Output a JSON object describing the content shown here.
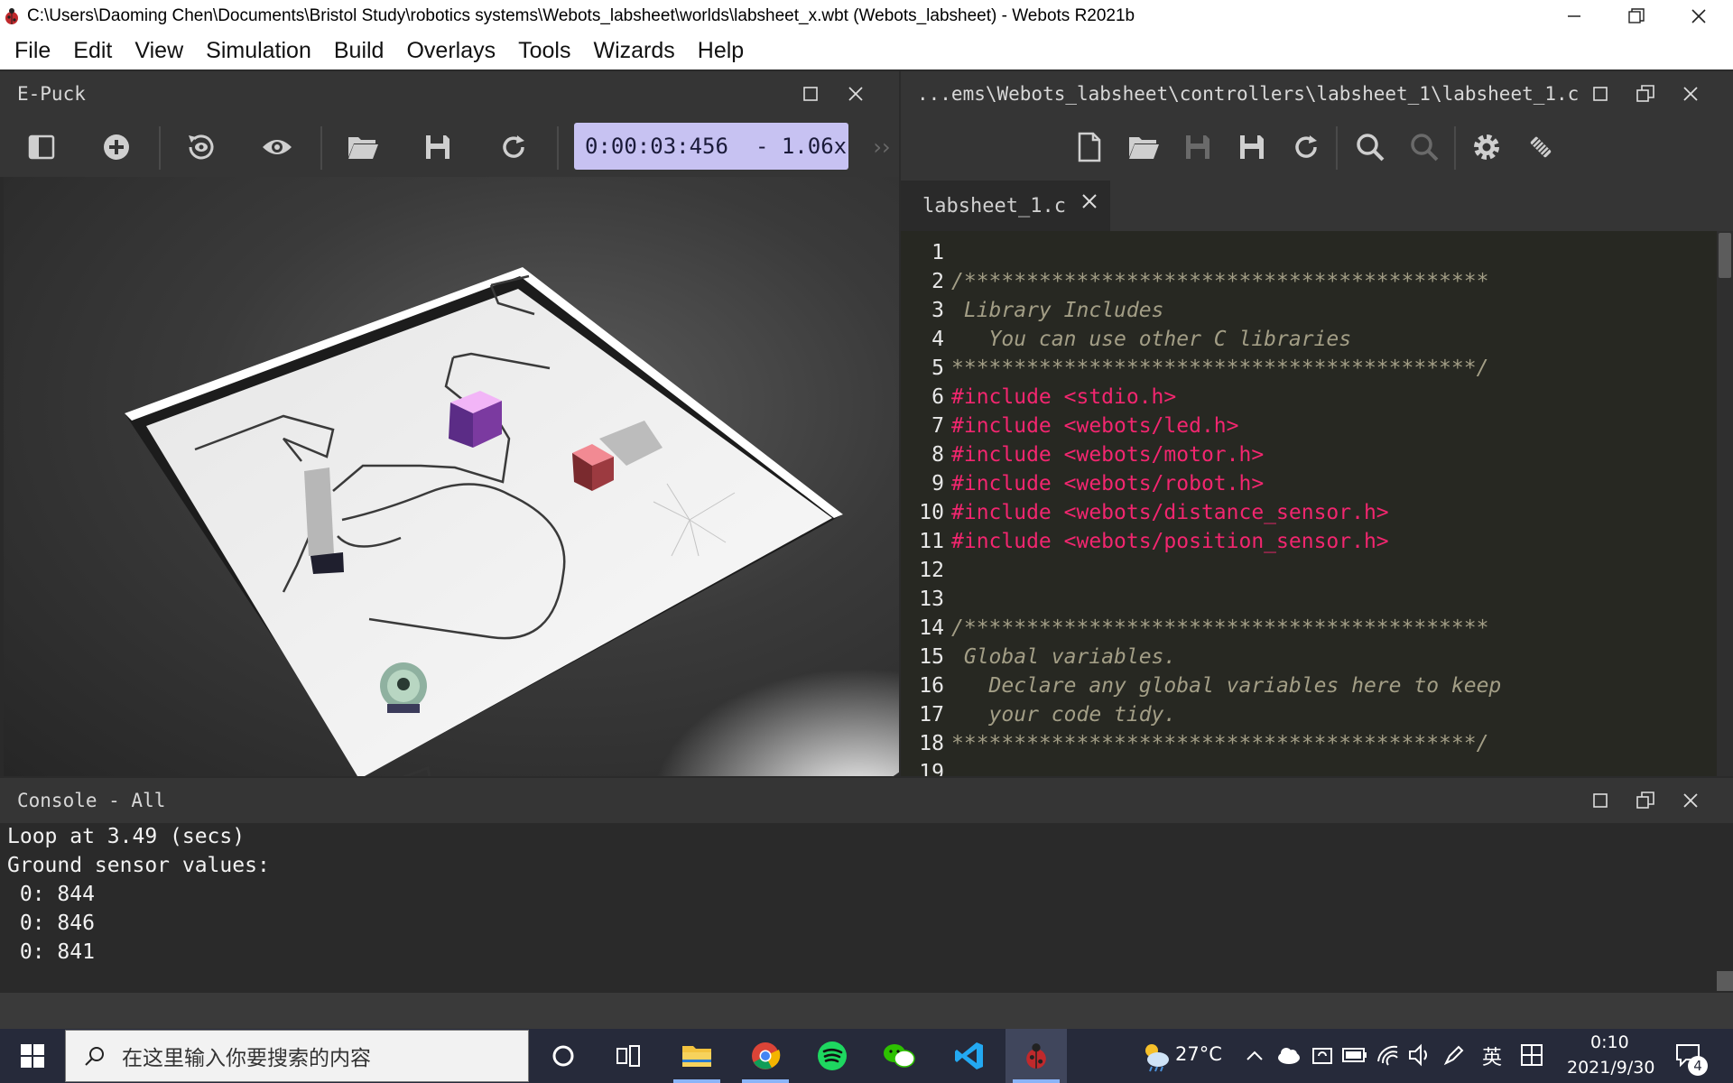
{
  "window": {
    "title": "C:\\Users\\Daoming Chen\\Documents\\Bristol Study\\robotics systems\\Webots_labsheet\\worlds\\labsheet_x.wbt (Webots_labsheet) - Webots R2021b"
  },
  "menu": [
    "File",
    "Edit",
    "View",
    "Simulation",
    "Build",
    "Overlays",
    "Tools",
    "Wizards",
    "Help"
  ],
  "scene_panel": {
    "title": "E-Puck",
    "time": "0:00:03:456",
    "speed": "-  1.06x",
    "more": "››"
  },
  "editor_panel": {
    "title": "...ems\\Webots_labsheet\\controllers\\labsheet_1\\labsheet_1.c",
    "tab_label": "labsheet_1.c",
    "lines": [
      {
        "n": "1",
        "text": "",
        "kind": "plain"
      },
      {
        "n": "2",
        "text": "/******************************************",
        "kind": "comment"
      },
      {
        "n": "3",
        "text": " Library Includes",
        "kind": "comment"
      },
      {
        "n": "4",
        "text": "   You can use other C libraries",
        "kind": "comment"
      },
      {
        "n": "5",
        "text": "******************************************/",
        "kind": "comment"
      },
      {
        "n": "6",
        "text": "#include <stdio.h>",
        "kind": "pre"
      },
      {
        "n": "7",
        "text": "#include <webots/led.h>",
        "kind": "pre"
      },
      {
        "n": "8",
        "text": "#include <webots/motor.h>",
        "kind": "pre"
      },
      {
        "n": "9",
        "text": "#include <webots/robot.h>",
        "kind": "pre"
      },
      {
        "n": "10",
        "text": "#include <webots/distance_sensor.h>",
        "kind": "pre"
      },
      {
        "n": "11",
        "text": "#include <webots/position_sensor.h>",
        "kind": "pre"
      },
      {
        "n": "12",
        "text": "",
        "kind": "plain"
      },
      {
        "n": "13",
        "text": "",
        "kind": "plain"
      },
      {
        "n": "14",
        "text": "/******************************************",
        "kind": "comment"
      },
      {
        "n": "15",
        "text": " Global variables.",
        "kind": "comment"
      },
      {
        "n": "16",
        "text": "   Declare any global variables here to keep",
        "kind": "comment"
      },
      {
        "n": "17",
        "text": "   your code tidy.",
        "kind": "comment"
      },
      {
        "n": "18",
        "text": "******************************************/",
        "kind": "comment"
      },
      {
        "n": "19",
        "text": "",
        "kind": "plain"
      }
    ]
  },
  "console": {
    "title": "Console - All",
    "lines": [
      "Loop at 3.49 (secs)",
      "Ground sensor values:",
      " 0: 844",
      " 0: 846",
      " 0: 841"
    ]
  },
  "taskbar": {
    "search_placeholder": "在这里输入你要搜索的内容",
    "weather": "27°C",
    "ime": "英",
    "time": "0:10",
    "date": "2021/9/30",
    "notifications": "4"
  },
  "colors": {
    "comment": "#a39e86",
    "preprocessor": "#f2266f",
    "time_bg": "#c7c2f2",
    "editor_bg": "#272822"
  }
}
